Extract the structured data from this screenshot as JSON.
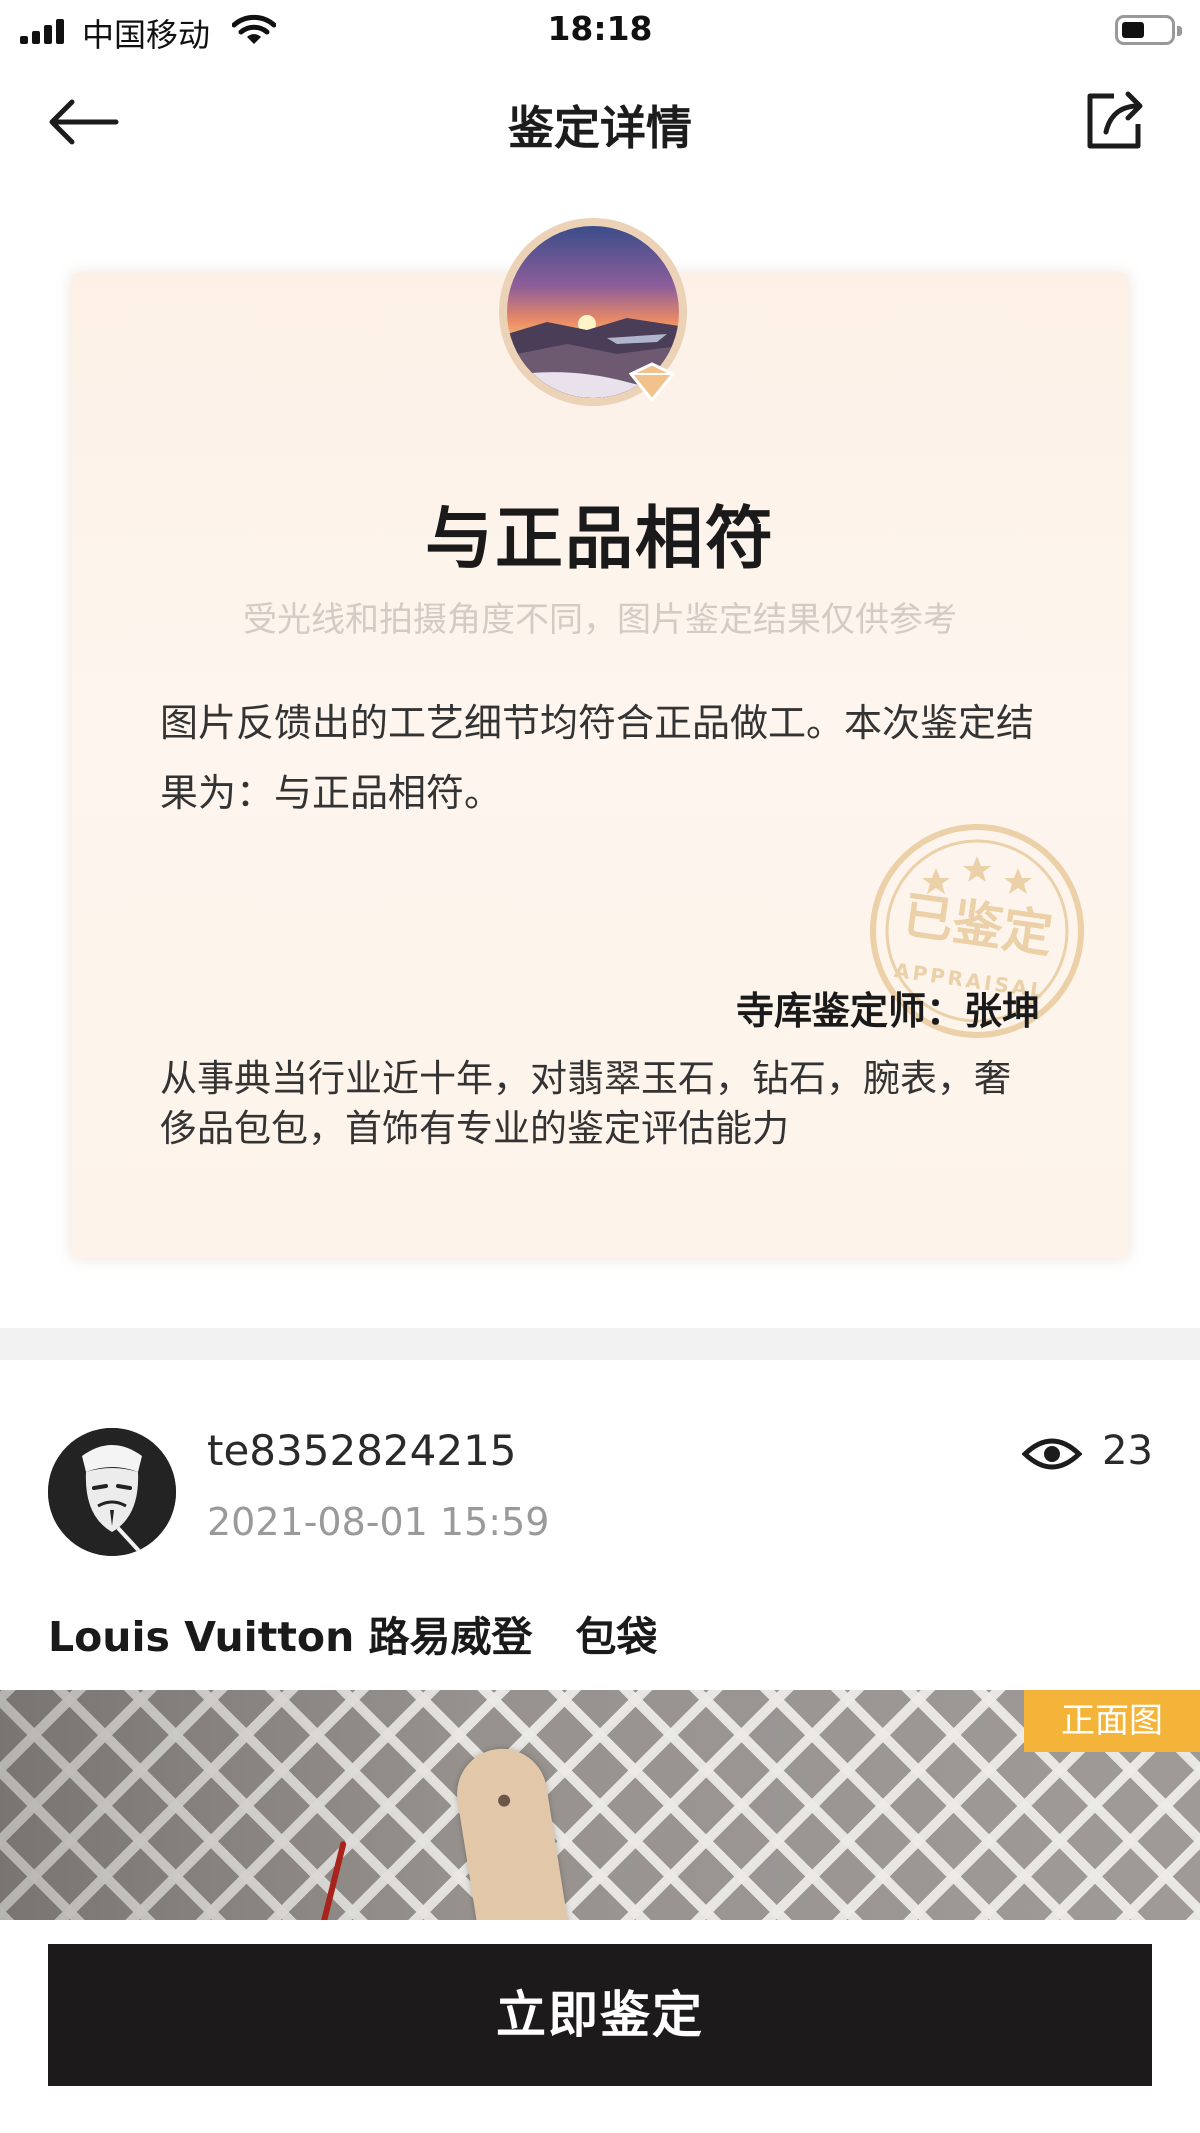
{
  "status_bar": {
    "carrier": "中国移动",
    "time": "18:18"
  },
  "nav": {
    "title": "鉴定详情",
    "back_icon": "arrow-left-icon",
    "share_icon": "share-icon"
  },
  "result": {
    "title": "与正品相符",
    "disclaimer": "受光线和拍摄角度不同，图片鉴定结果仅供参考",
    "description": "图片反馈出的工艺细节均符合正品做工。本次鉴定结果为：与正品相符。",
    "stamp_text": "已鉴定",
    "stamp_sub": "APPRAISAL",
    "appraiser": "寺库鉴定师：张坤",
    "bio": "从事典当行业近十年，对翡翠玉石，钻石，腕表，奢侈品包包，首饰有专业的鉴定评估能力"
  },
  "post": {
    "username": "te8352824215",
    "time": "2021-08-01 15:59",
    "views": "23",
    "item_title": "Louis Vuitton 路易威登   包袋",
    "photo_tag": "正面图"
  },
  "cta": {
    "label": "立即鉴定"
  },
  "colors": {
    "card_bg": "#fdf3ea",
    "stamp": "#e7c38a",
    "tag": "#f4b43a",
    "cta_bg": "#1c1a1a"
  }
}
